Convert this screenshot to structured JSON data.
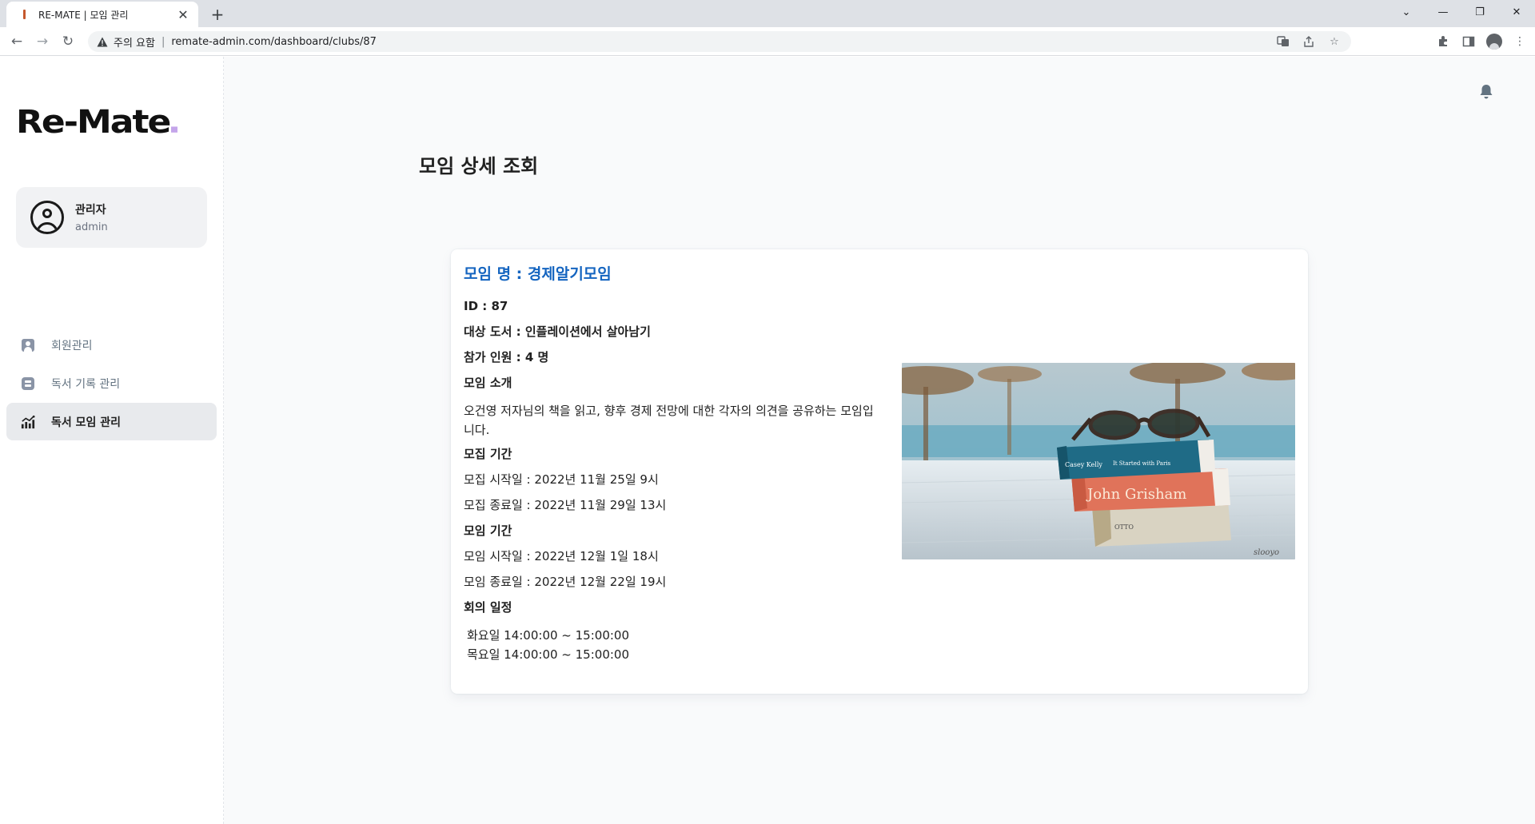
{
  "browser": {
    "tab_title": "RE-MATE | 모임 관리",
    "security_label": "주의 요함",
    "url": "remate-admin.com/dashboard/clubs/87"
  },
  "sidebar": {
    "logo": "Re-Mate",
    "user": {
      "name": "관리자",
      "role": "admin"
    },
    "items": [
      {
        "label": "회원관리",
        "icon": "user-icon",
        "active": false
      },
      {
        "label": "독서 기록 관리",
        "icon": "blog-icon",
        "active": false
      },
      {
        "label": "독서 모임 관리",
        "icon": "analytics-icon",
        "active": true
      }
    ]
  },
  "header": {
    "title": "모임 상세 조회",
    "icon": "bell-icon"
  },
  "club": {
    "title": "모임 명 : 경제알기모임",
    "id": "ID : 87",
    "book": "대상 도서 : 인플레이션에서 살아남기",
    "members": "참가 인원 : 4 명",
    "intro_heading": "모임 소개",
    "intro_text": "오건영 저자님의 책을 읽고, 향후 경제 전망에 대한 각자의 의견을 공유하는 모임입니다.",
    "recruit_heading": "모집 기간",
    "recruit_start": "모집 시작일 : 2022년 11월 25일 9시",
    "recruit_end": "모집 종료일 : 2022년 11월 29일 13시",
    "meeting_heading": "모임 기간",
    "meeting_start": "모임 시작일 : 2022년 12월 1일 18시",
    "meeting_end": "모임 종료일 : 2022년 12월 22일 19시",
    "schedule_heading": "회의 일정",
    "schedule": [
      "화요일 14:00:00 ~ 15:00:00",
      "목요일 14:00:00 ~ 15:00:00"
    ],
    "image": {
      "alt": "books-with-sunglasses-photo",
      "book_titles": [
        "Casey Kelly",
        "It Started with Paris",
        "John Grisham"
      ],
      "watermark": "slooyo"
    }
  },
  "colors": {
    "accent": "#1565c0",
    "logo_dot": "#c4a5ea",
    "active_nav_bg": "#e8eaed",
    "page_bg": "#f9fafb"
  }
}
